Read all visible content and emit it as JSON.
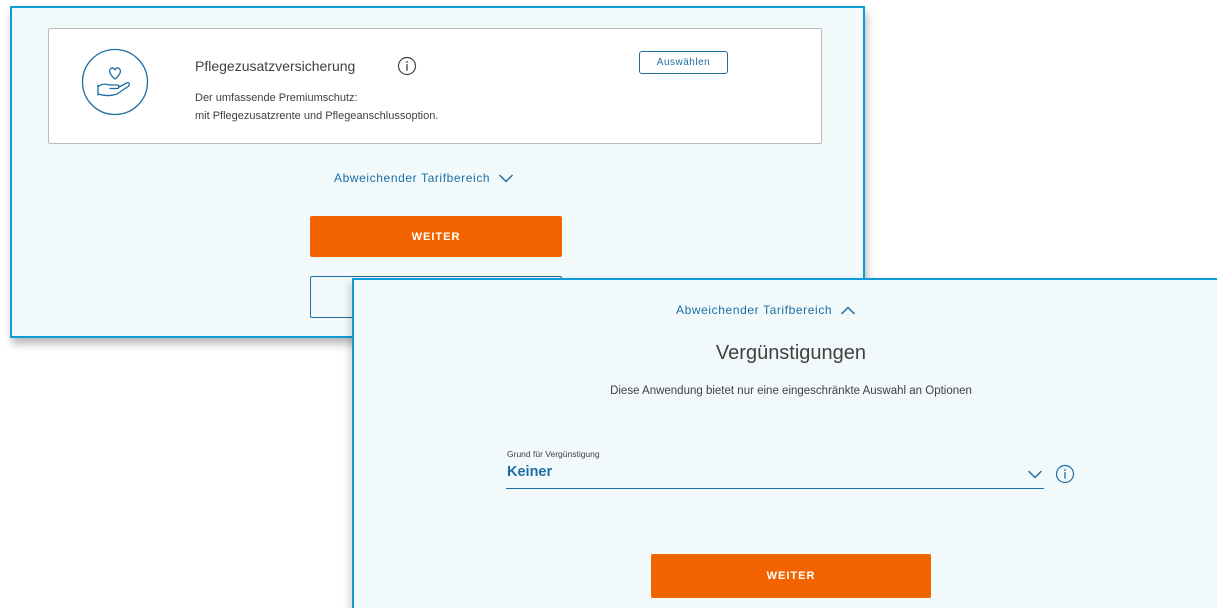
{
  "back_panel": {
    "card": {
      "icon": "heart-in-hand-icon",
      "title": "Pflegezusatzversicherung",
      "info_icon": "info-icon",
      "description_lines": [
        "Der umfassende Premiumschutz:",
        "mit Pflegezusatzrente und Pflegeanschlussoption."
      ],
      "select_label": "Auswählen"
    },
    "toggle": {
      "label": "Abweichender Tarifbereich",
      "icon": "chevron-down-icon"
    },
    "primary_button": "WEITER"
  },
  "front_panel": {
    "toggle": {
      "label": "Abweichender Tarifbereich",
      "icon": "chevron-up-icon"
    },
    "heading": "Vergünstigungen",
    "subtext": "Diese Anwendung bietet nur eine eingeschränkte Auswahl an Optionen",
    "select_field": {
      "label": "Grund für Vergünstigung",
      "value": "Keiner",
      "icon": "chevron-down-icon",
      "info_icon": "info-icon"
    },
    "primary_button": "WEITER"
  },
  "colors": {
    "accent_blue": "#1e6ea3",
    "panel_border": "#0f9bd7",
    "panel_background": "#f1f9fa",
    "primary_orange": "#f36400"
  }
}
